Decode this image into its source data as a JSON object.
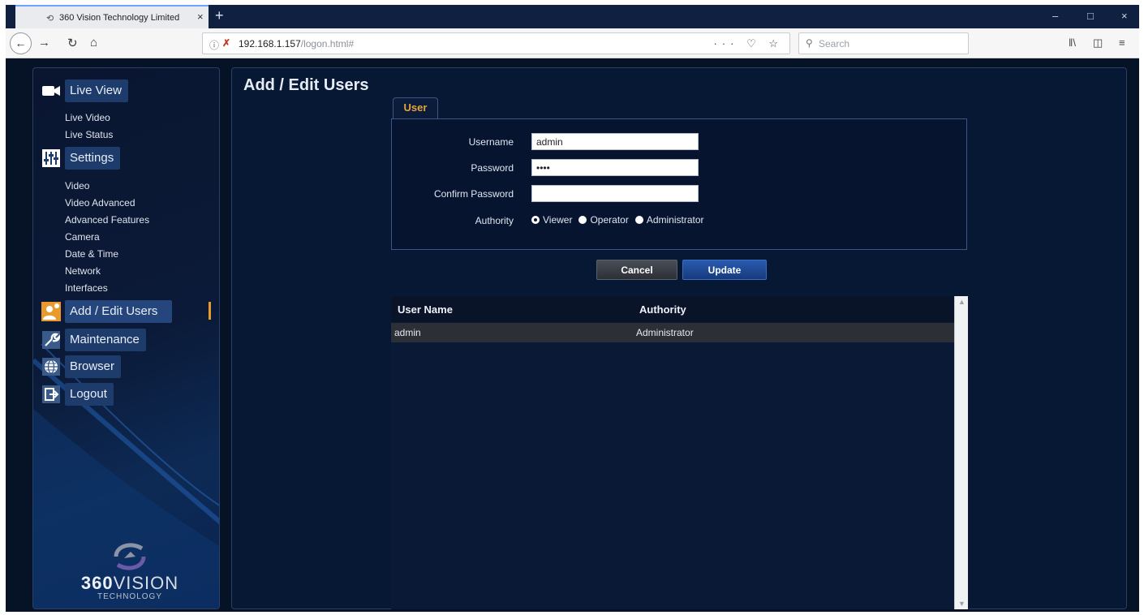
{
  "browser": {
    "tab_title": "360 Vision Technology Limited",
    "tab_close": "×",
    "new_tab": "+",
    "url_host": "192.168.1.157",
    "url_path": "/logon.html#",
    "search_placeholder": "Search",
    "window": {
      "minimize": "–",
      "maximize": "□",
      "close": "×"
    }
  },
  "sidebar": {
    "menu": [
      {
        "label": "Live View",
        "icon": "camera-icon"
      },
      {
        "label": "Settings",
        "icon": "sliders-icon"
      },
      {
        "label": "Add / Edit Users",
        "icon": "users-icon",
        "active": true
      },
      {
        "label": "Maintenance",
        "icon": "wrench-icon"
      },
      {
        "label": "Browser",
        "icon": "globe-icon"
      },
      {
        "label": "Logout",
        "icon": "logout-icon"
      }
    ],
    "live_view_items": [
      "Live Video",
      "Live Status"
    ],
    "settings_items": [
      "Video",
      "Video Advanced",
      "Advanced Features",
      "Camera",
      "Date & Time",
      "Network",
      "Interfaces"
    ],
    "logo": {
      "brand_a": "360",
      "brand_b": "VISION",
      "tagline": "TECHNOLOGY"
    }
  },
  "main": {
    "title": "Add / Edit Users",
    "tab_label": "User",
    "form": {
      "username_label": "Username",
      "username_value": "admin",
      "password_label": "Password",
      "password_value": "••••",
      "confirm_label": "Confirm Password",
      "confirm_value": "",
      "authority_label": "Authority",
      "authority_options": [
        "Viewer",
        "Operator",
        "Administrator"
      ],
      "authority_selected": "Viewer"
    },
    "cancel_label": "Cancel",
    "update_label": "Update",
    "table": {
      "headers": [
        "User Name",
        "Authority"
      ],
      "rows": [
        [
          "admin",
          "Administrator"
        ]
      ]
    }
  }
}
